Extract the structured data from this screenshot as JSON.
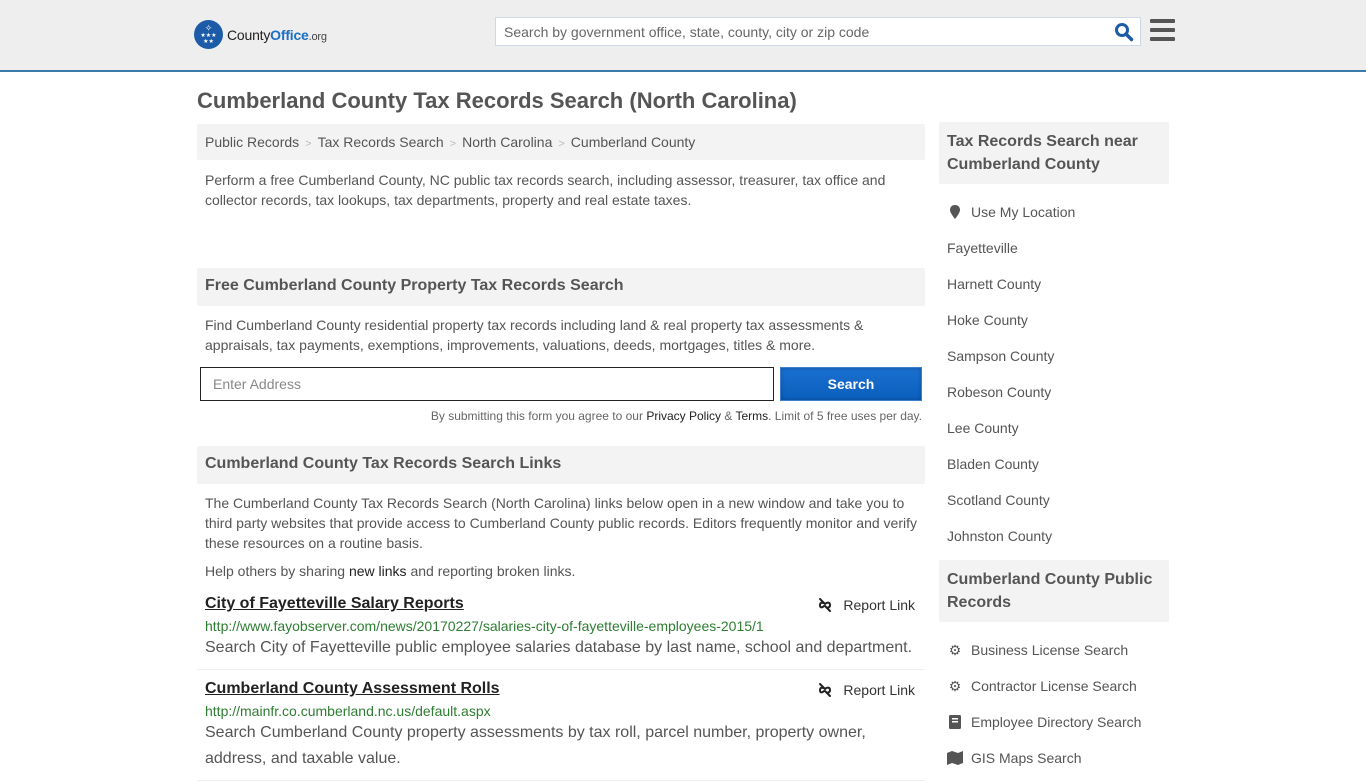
{
  "header": {
    "logo": {
      "county": "County",
      "office": "Office",
      "org": ".org"
    },
    "search_placeholder": "Search by government office, state, county, city or zip code"
  },
  "page_title": "Cumberland County Tax Records Search (North Carolina)",
  "breadcrumb": [
    "Public Records",
    "Tax Records Search",
    "North Carolina",
    "Cumberland County"
  ],
  "intro": "Perform a free Cumberland County, NC public tax records search, including assessor, treasurer, tax office and collector records, tax lookups, tax departments, property and real estate taxes.",
  "property_search": {
    "heading": "Free Cumberland County Property Tax Records Search",
    "description": "Find Cumberland County residential property tax records including land & real property tax assessments & appraisals, tax payments, exemptions, improvements, valuations, deeds, mortgages, titles & more.",
    "address_placeholder": "Enter Address",
    "button_label": "Search",
    "disclaimer_prefix": "By submitting this form you agree to our ",
    "privacy_label": "Privacy Policy",
    "amp": " & ",
    "terms_label": "Terms",
    "disclaimer_suffix": ". Limit of 5 free uses per day."
  },
  "links_section": {
    "heading": "Cumberland County Tax Records Search Links",
    "description": "The Cumberland County Tax Records Search (North Carolina) links below open in a new window and take you to third party websites that provide access to Cumberland County public records. Editors frequently monitor and verify these resources on a routine basis.",
    "help_prefix": "Help others by sharing ",
    "help_link": "new links",
    "help_suffix": " and reporting broken links.",
    "report_label": "Report Link",
    "items": [
      {
        "title": "City of Fayetteville Salary Reports",
        "url": "http://www.fayobserver.com/news/20170227/salaries-city-of-fayetteville-employees-2015/1",
        "description": "Search City of Fayetteville public employee salaries database by last name, school and department."
      },
      {
        "title": "Cumberland County Assessment Rolls",
        "url": "http://mainfr.co.cumberland.nc.us/default.aspx",
        "description": "Search Cumberland County property assessments by tax roll, parcel number, property owner, address, and taxable value."
      }
    ]
  },
  "sidebar": {
    "nearby": {
      "heading": "Tax Records Search near Cumberland County",
      "use_location": "Use My Location",
      "items": [
        "Fayetteville",
        "Harnett County",
        "Hoke County",
        "Sampson County",
        "Robeson County",
        "Lee County",
        "Bladen County",
        "Scotland County",
        "Johnston County"
      ]
    },
    "public_records": {
      "heading": "Cumberland County Public Records",
      "items": [
        {
          "label": "Business License Search",
          "icon": "gears-icon"
        },
        {
          "label": "Contractor License Search",
          "icon": "gear-icon"
        },
        {
          "label": "Employee Directory Search",
          "icon": "book-icon"
        },
        {
          "label": "GIS Maps Search",
          "icon": "map-icon"
        }
      ]
    }
  }
}
